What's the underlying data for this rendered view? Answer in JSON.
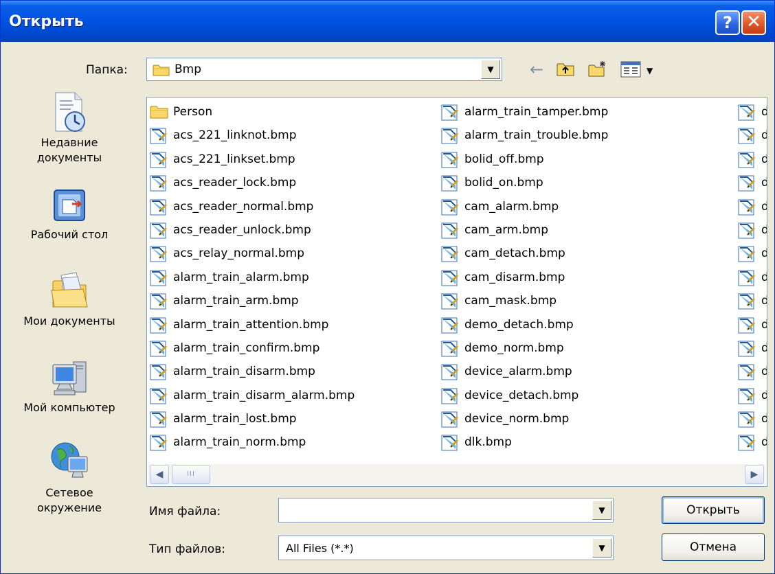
{
  "window": {
    "title": "Открыть"
  },
  "lookin": {
    "label": "Папка:",
    "value": "Bmp"
  },
  "places": [
    {
      "label": "Недавние документы"
    },
    {
      "label": "Рабочий стол"
    },
    {
      "label": "Мои документы"
    },
    {
      "label": "Мой компьютер"
    },
    {
      "label": "Сетевое окружение"
    }
  ],
  "files": {
    "col1": [
      "Person",
      "acs_221_linknot.bmp",
      "acs_221_linkset.bmp",
      "acs_reader_lock.bmp",
      "acs_reader_normal.bmp",
      "acs_reader_unlock.bmp",
      "acs_relay_normal.bmp",
      "alarm_train_alarm.bmp",
      "alarm_train_arm.bmp",
      "alarm_train_attention.bmp",
      "alarm_train_confirm.bmp",
      "alarm_train_disarm.bmp",
      "alarm_train_disarm_alarm.bmp",
      "alarm_train_lost.bmp",
      "alarm_train_norm.bmp"
    ],
    "col2": [
      "alarm_train_tamper.bmp",
      "alarm_train_trouble.bmp",
      "bolid_off.bmp",
      "bolid_on.bmp",
      "cam_alarm.bmp",
      "cam_arm.bmp",
      "cam_detach.bmp",
      "cam_disarm.bmp",
      "cam_mask.bmp",
      "demo_detach.bmp",
      "demo_norm.bmp",
      "device_alarm.bmp",
      "device_detach.bmp",
      "device_norm.bmp",
      "dlk.bmp"
    ],
    "col3": [
      "d",
      "d",
      "d",
      "d",
      "d",
      "d",
      "d",
      "d",
      "d",
      "d",
      "d",
      "d",
      "d",
      "d",
      "d"
    ]
  },
  "scrollbar": {
    "thumb_grip": "III"
  },
  "filename": {
    "label": "Имя файла:",
    "value": ""
  },
  "filetype": {
    "label": "Тип файлов:",
    "value": "All Files (*.*)"
  },
  "buttons": {
    "open": "Открыть",
    "cancel": "Отмена"
  },
  "colors": {
    "titlebar": "#0054e3",
    "dialog_bg": "#ece9d8",
    "border": "#7f9db9"
  }
}
